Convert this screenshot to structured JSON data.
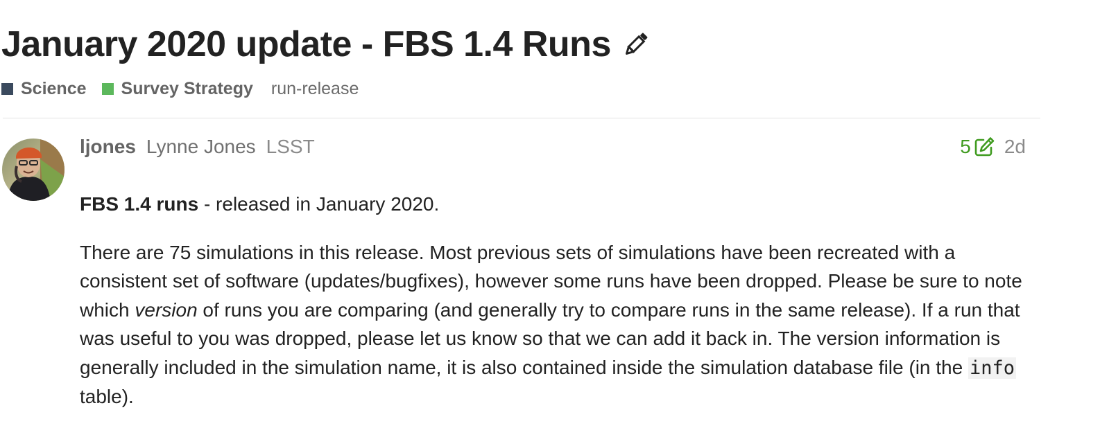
{
  "topic": {
    "title": "January 2020 update - FBS 1.4 Runs",
    "edit_icon": "pencil-icon",
    "categories": [
      {
        "label": "Science",
        "color": "#3b4a5e"
      },
      {
        "label": "Survey Strategy",
        "color": "#5cb85c"
      }
    ],
    "tags": [
      "run-release"
    ]
  },
  "post": {
    "username": "ljones",
    "full_name": "Lynne Jones",
    "user_title": "LSST",
    "edit_count": "5",
    "edit_icon": "edit-history-icon",
    "edit_color": "#3f9b1f",
    "date": "2d",
    "body": {
      "p1_bold": "FBS 1.4 runs",
      "p1_rest": " - released in January 2020.",
      "p2_part1": "There are 75 simulations in this release. Most previous sets of simulations have been recreated with a consistent set of software (updates/bugfixes), however some runs have been dropped. Please be sure to note which ",
      "p2_italic": "version",
      "p2_part2": " of runs you are comparing (and generally try to compare runs in the same release). If a run that was useful to you was dropped, please let us know so that we can add it back in. The version information is generally included in the simulation name, it is also contained inside the simulation database file (in the ",
      "p2_code": "info",
      "p2_part3": " table)."
    }
  }
}
